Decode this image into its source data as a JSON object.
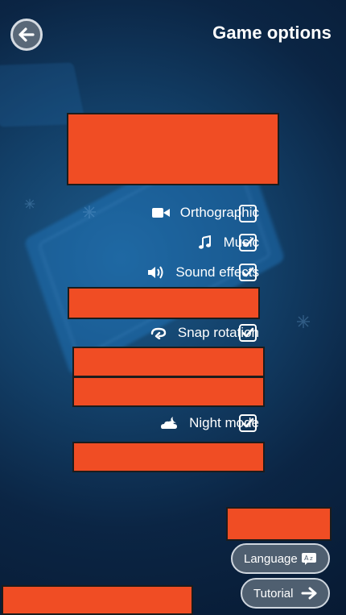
{
  "header": {
    "title": "Game options"
  },
  "options": [
    {
      "label": "Orthographic",
      "icon": "video-camera-icon",
      "checked": false
    },
    {
      "label": "Music",
      "icon": "music-note-icon",
      "checked": true
    },
    {
      "label": "Sound effects",
      "icon": "speaker-icon",
      "checked": true
    },
    {
      "label": "Snap rotation",
      "icon": "rotation-icon",
      "checked": true
    },
    {
      "label": "Night mode",
      "icon": "night-mode-icon",
      "checked": true
    }
  ],
  "bottom": {
    "language_label": "Language",
    "tutorial_label": "Tutorial"
  },
  "colors": {
    "redaction": "#f04d24",
    "pill_bg": "#4f5f70",
    "pill_border": "#cfd6de"
  }
}
